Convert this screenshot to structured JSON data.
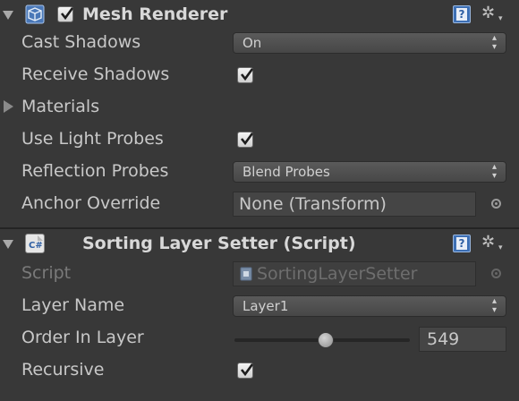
{
  "colors": {
    "panel_bg": "#383838",
    "help_blue": "#3d6fb4"
  },
  "mesh_renderer": {
    "title": "Mesh Renderer",
    "enabled": true,
    "icon": "mesh-renderer-icon",
    "help_glyph": "?",
    "gear_glyph": "✲",
    "caret_glyph": "▾",
    "fields": {
      "cast_shadows": {
        "label": "Cast Shadows",
        "value": "On"
      },
      "receive_shadows": {
        "label": "Receive Shadows",
        "checked": true
      },
      "materials": {
        "label": "Materials",
        "expanded": false
      },
      "use_light_probes": {
        "label": "Use Light Probes",
        "checked": true
      },
      "reflection_probes": {
        "label": "Reflection Probes",
        "value": "Blend Probes"
      },
      "anchor_override": {
        "label": "Anchor Override",
        "value": "None (Transform)"
      }
    }
  },
  "sorting_layer_setter": {
    "title": "Sorting Layer Setter (Script)",
    "icon": "csharp-script-icon",
    "icon_glyph": "C#",
    "help_glyph": "?",
    "gear_glyph": "✲",
    "caret_glyph": "▾",
    "fields": {
      "script": {
        "label": "Script",
        "value": "SortingLayerSetter"
      },
      "layer_name": {
        "label": "Layer Name",
        "value": "Layer1"
      },
      "order_in_layer": {
        "label": "Order In Layer",
        "value": "549",
        "slider_fraction": 0.52
      },
      "recursive": {
        "label": "Recursive",
        "checked": true
      }
    }
  },
  "dropdown_arrows": {
    "up": "▴",
    "down": "▾"
  }
}
